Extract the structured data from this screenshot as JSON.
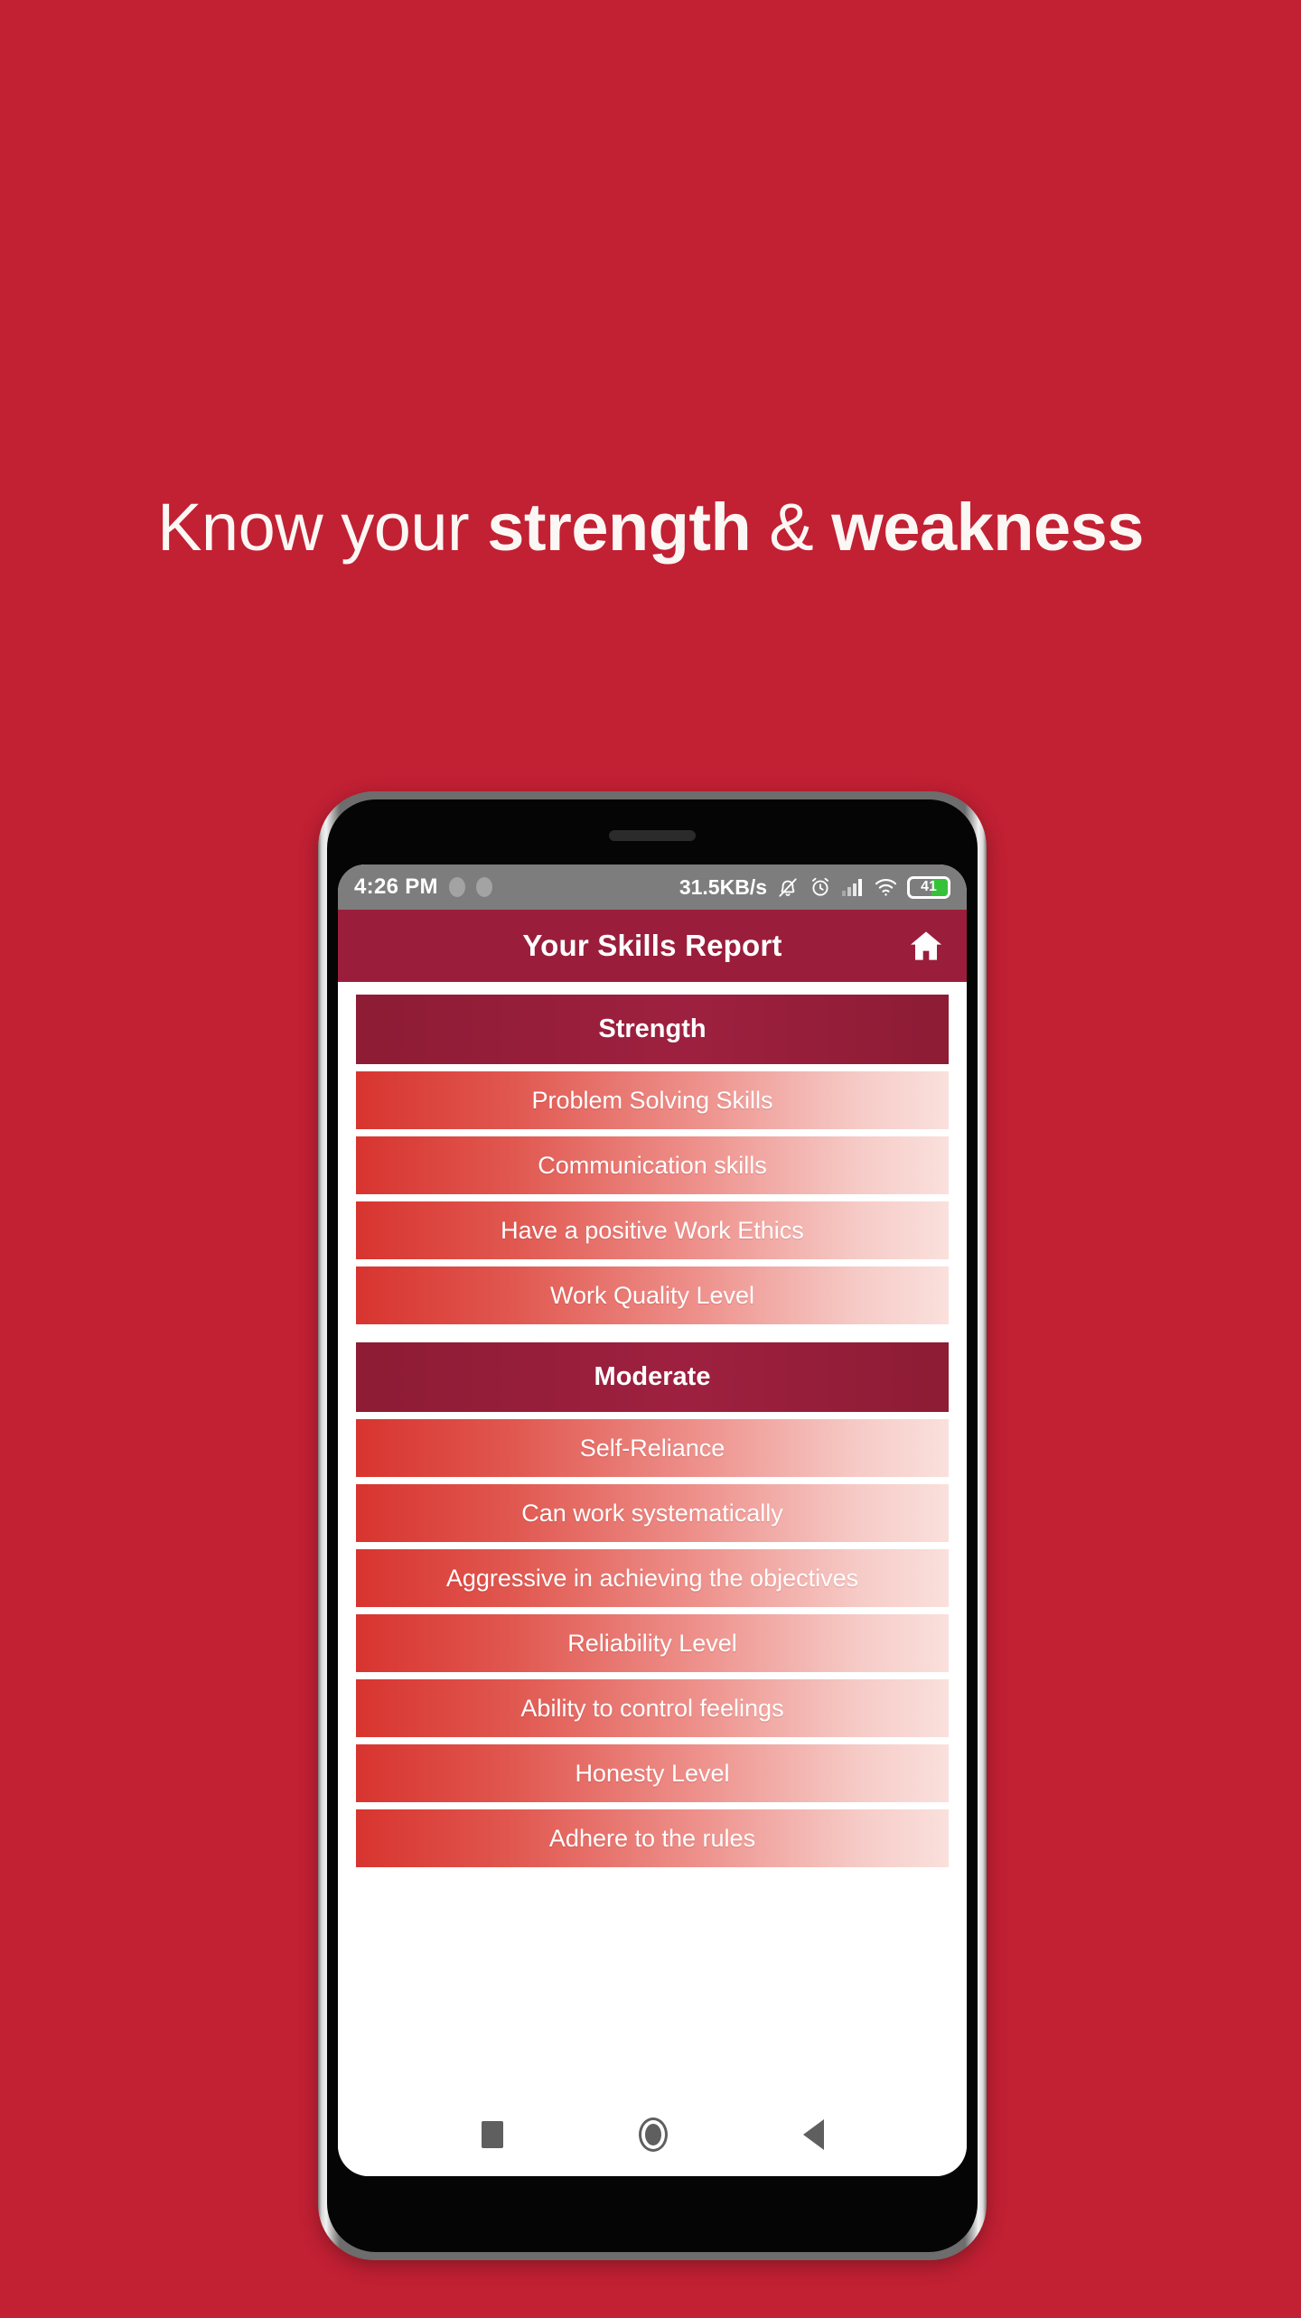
{
  "promo": {
    "background_color": "#C22033",
    "headline": {
      "part1": "Know your ",
      "part2": "strength",
      "part3": " & ",
      "part4": "weakness"
    }
  },
  "phone": {
    "status_bar": {
      "time": "4:26 PM",
      "network_speed": "31.5KB/s",
      "battery_level": "41",
      "icons": [
        "bell-off-icon",
        "alarm-icon",
        "signal-icon",
        "wifi-icon",
        "battery-icon"
      ]
    },
    "app_bar": {
      "title": "Your Skills Report",
      "home_icon": "home-icon"
    },
    "nav_bar": {
      "recents": "recents-square-icon",
      "home": "home-circle-icon",
      "back": "back-triangle-icon"
    }
  },
  "report": {
    "sections": [
      {
        "title": "Strength",
        "items": [
          "Problem Solving Skills",
          "Communication skills",
          "Have a positive Work Ethics",
          "Work Quality Level"
        ]
      },
      {
        "title": "Moderate",
        "items": [
          "Self-Reliance",
          "Can work systematically",
          "Aggressive in achieving the objectives",
          "Reliability Level",
          "Ability to control feelings",
          "Honesty Level",
          "Adhere to the rules"
        ]
      }
    ]
  },
  "colors": {
    "brand_red": "#C22033",
    "header_maroon": "#9A1E3B",
    "section_maroon": "#8D1C34",
    "row_gradient_start": "#D8342F",
    "row_gradient_end": "#FAE0DC",
    "battery_green": "#36C238"
  }
}
